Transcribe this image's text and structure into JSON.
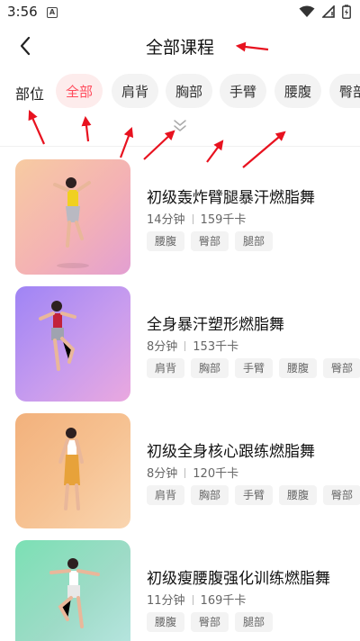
{
  "status_bar": {
    "time": "3:56",
    "notification_glyph": "A"
  },
  "header": {
    "title": "全部课程"
  },
  "filter": {
    "label": "部位",
    "chips": [
      "全部",
      "肩背",
      "胸部",
      "手臂",
      "腰腹",
      "臀部"
    ],
    "active_chip": "全部"
  },
  "courses": [
    {
      "title": "初级轰炸臂腿暴汗燃脂舞",
      "duration": "14分钟",
      "calories": "159千卡",
      "tags": [
        "腰腹",
        "臀部",
        "腿部"
      ]
    },
    {
      "title": "全身暴汗塑形燃脂舞",
      "duration": "8分钟",
      "calories": "153千卡",
      "tags": [
        "肩背",
        "胸部",
        "手臂",
        "腰腹",
        "臀部"
      ]
    },
    {
      "title": "初级全身核心跟练燃脂舞",
      "duration": "8分钟",
      "calories": "120千卡",
      "tags": [
        "肩背",
        "胸部",
        "手臂",
        "腰腹",
        "臀部"
      ]
    },
    {
      "title": "初级瘦腰腹强化训练燃脂舞",
      "duration": "11分钟",
      "calories": "169千卡",
      "tags": [
        "腰腹",
        "臀部",
        "腿部"
      ]
    }
  ],
  "colors": {
    "accent": "#ff4b5c",
    "chip_bg": "#f3f3f3",
    "annotation_arrow": "#e8121f"
  },
  "icons": [
    "wifi-icon",
    "signal-icon",
    "battery-icon",
    "back-arrow-icon",
    "expand-chevron-icon"
  ]
}
